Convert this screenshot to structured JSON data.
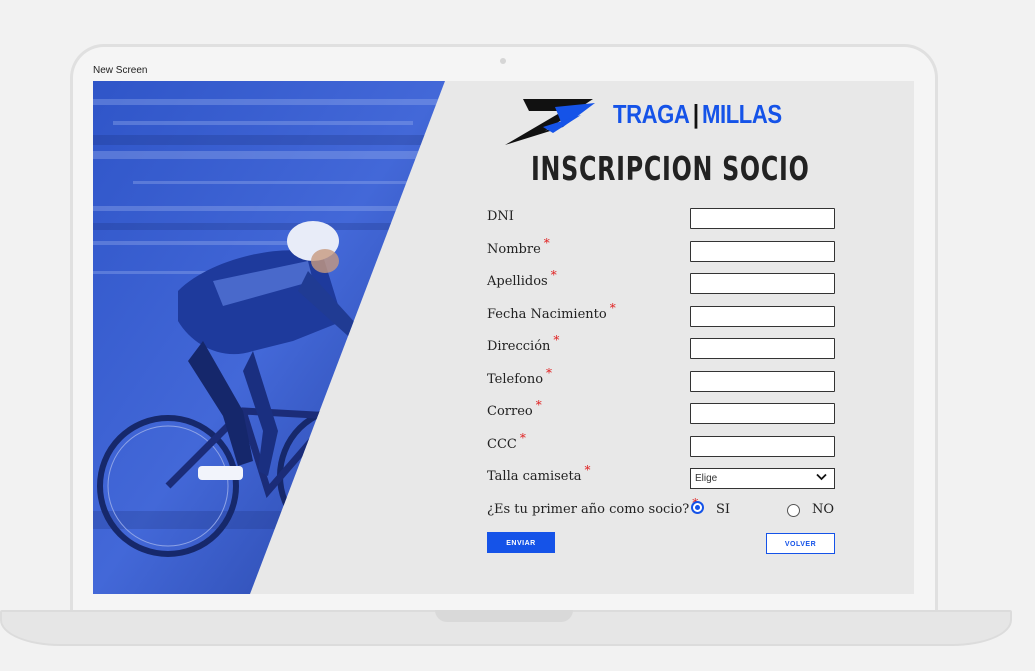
{
  "screen_label": "New Screen",
  "brand": {
    "left": "TRAGA",
    "sep": "|",
    "right": "MILLAS"
  },
  "title": "INSCRIPCION SOCIO",
  "required_mark": "*",
  "fields": [
    {
      "label": "DNI",
      "required": false,
      "value": ""
    },
    {
      "label": "Nombre",
      "required": true,
      "value": ""
    },
    {
      "label": "Apellidos",
      "required": true,
      "value": ""
    },
    {
      "label": "Fecha Nacimiento",
      "required": true,
      "value": ""
    },
    {
      "label": "Dirección",
      "required": true,
      "value": ""
    },
    {
      "label": "Telefono",
      "required": true,
      "value": ""
    },
    {
      "label": "Correo",
      "required": true,
      "value": ""
    },
    {
      "label": "CCC",
      "required": true,
      "value": ""
    }
  ],
  "talla": {
    "label": "Talla camiseta",
    "selected": "Elige"
  },
  "primer_ano": {
    "label": "¿Es tu primer año como socio?",
    "options": [
      {
        "label": "SI",
        "checked": true
      },
      {
        "label": "NO",
        "checked": false
      }
    ]
  },
  "buttons": {
    "enviar": "ENVIAR",
    "volver": "VOLVER"
  },
  "colors": {
    "accent": "#1553e8",
    "required": "#e02020",
    "panel": "#e8e8e8"
  }
}
